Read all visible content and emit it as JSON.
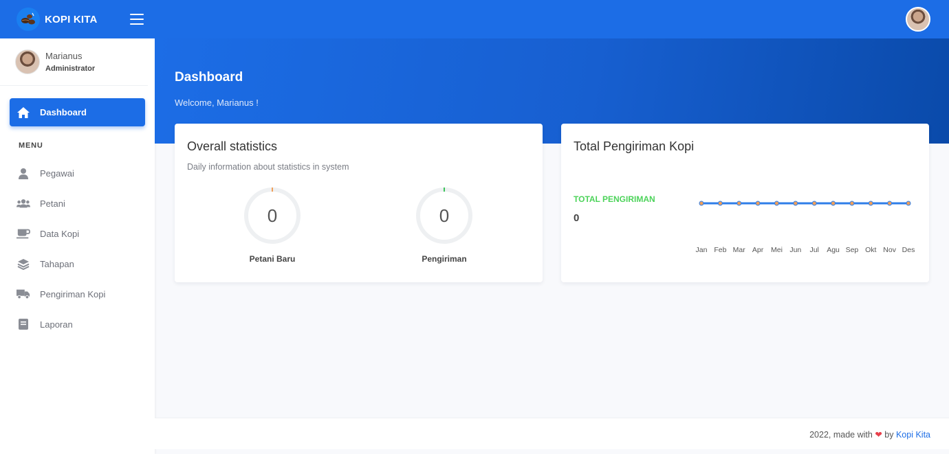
{
  "brand": {
    "name": "KOPI KITA"
  },
  "user": {
    "name": "Marianus",
    "role": "Administrator"
  },
  "sidebar": {
    "active": {
      "label": "Dashboard",
      "icon": "home-icon"
    },
    "menu_heading": "MENU",
    "items": [
      {
        "label": "Pegawai",
        "icon": "user-icon"
      },
      {
        "label": "Petani",
        "icon": "users-icon"
      },
      {
        "label": "Data Kopi",
        "icon": "coffee-cup-icon"
      },
      {
        "label": "Tahapan",
        "icon": "layers-icon"
      },
      {
        "label": "Pengiriman Kopi",
        "icon": "truck-icon"
      },
      {
        "label": "Laporan",
        "icon": "book-icon"
      }
    ]
  },
  "hero": {
    "title": "Dashboard",
    "subtitle": "Welcome, Marianus !"
  },
  "stats_card": {
    "title": "Overall statistics",
    "subtitle": "Daily information about statistics in system",
    "gauges": [
      {
        "value": "0",
        "label": "Petani Baru",
        "accent": "#f0a05a"
      },
      {
        "value": "0",
        "label": "Pengiriman",
        "accent": "#3cc45a"
      }
    ]
  },
  "shipping_card": {
    "title": "Total Pengiriman Kopi",
    "total_label": "TOTAL PENGIRIMAN",
    "total_value": "0"
  },
  "chart_data": {
    "type": "line",
    "categories": [
      "Jan",
      "Feb",
      "Mar",
      "Apr",
      "Mei",
      "Jun",
      "Jul",
      "Agu",
      "Sep",
      "Okt",
      "Nov",
      "Des"
    ],
    "series": [
      {
        "values": [
          0,
          0,
          0,
          0,
          0,
          0,
          0,
          0,
          0,
          0,
          0,
          0
        ],
        "color": "#2f7ee8",
        "marker_color": "#f0a05a"
      }
    ],
    "title": "",
    "xlabel": "",
    "ylabel": "",
    "grid": false
  },
  "footer": {
    "prefix": "2022, made with",
    "by": "by",
    "link": "Kopi Kita"
  },
  "colors": {
    "primary": "#1c6de6",
    "success": "#4cd35a",
    "heart": "#e8404b"
  }
}
